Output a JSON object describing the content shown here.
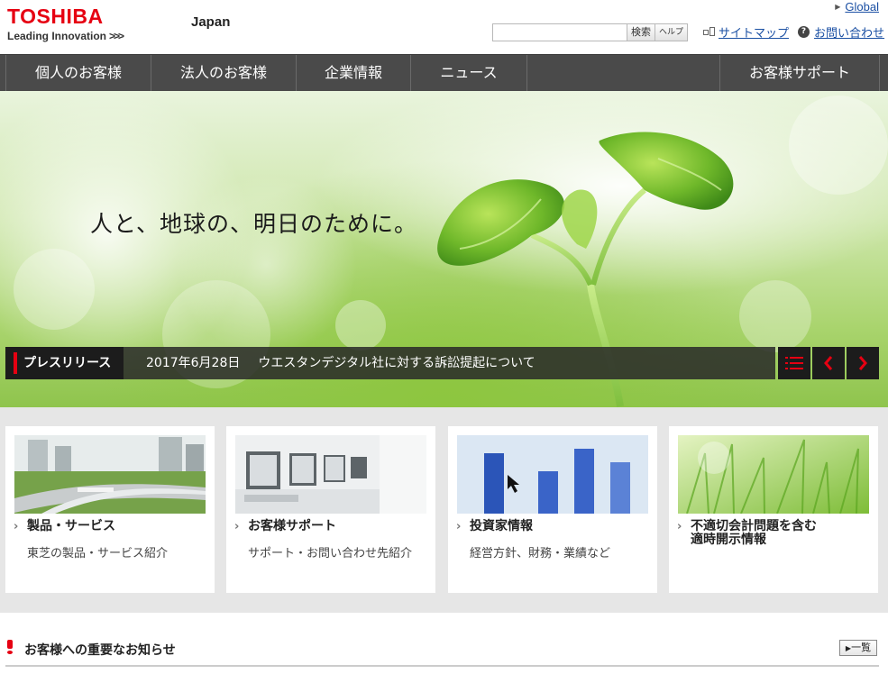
{
  "brand": {
    "name": "TOSHIBA",
    "tagline": "Leading Innovation",
    "tagline_mark": ">>>",
    "region": "Japan",
    "red": "#e60012"
  },
  "header": {
    "global_link": "Global",
    "search": {
      "placeholder": "",
      "value": "",
      "search_button": "検索",
      "help_button": "ヘルプ"
    },
    "sitemap_link": "サイトマップ",
    "contact_link": "お問い合わせ"
  },
  "nav": {
    "items": [
      {
        "label": "個人のお客様"
      },
      {
        "label": "法人のお客様"
      },
      {
        "label": "企業情報"
      },
      {
        "label": "ニュース"
      },
      {
        "label": "お客様サポート"
      }
    ]
  },
  "hero": {
    "tagline": "人と、地球の、明日のために。",
    "press": {
      "label": "プレスリリース",
      "date": "2017年6月28日",
      "headline": "ウエスタンデジタル社に対する訴訟提起について"
    },
    "controls": {
      "list_icon": "list-icon",
      "prev_icon": "chevron-left-icon",
      "next_icon": "chevron-right-icon"
    }
  },
  "cards": [
    {
      "title": "製品・サービス",
      "desc": "東芝の製品・サービス紹介"
    },
    {
      "title": "お客様サポート",
      "desc": "サポート・お問い合わせ先紹介"
    },
    {
      "title": "投資家情報",
      "desc": "経営方針、財務・業績など"
    },
    {
      "title_line1": "不適切会計問題を含む",
      "title_line2": "適時開示情報",
      "desc": ""
    }
  ],
  "notice": {
    "title": "お客様への重要なお知らせ",
    "more_button": "一覧",
    "more_mark": "▶"
  }
}
